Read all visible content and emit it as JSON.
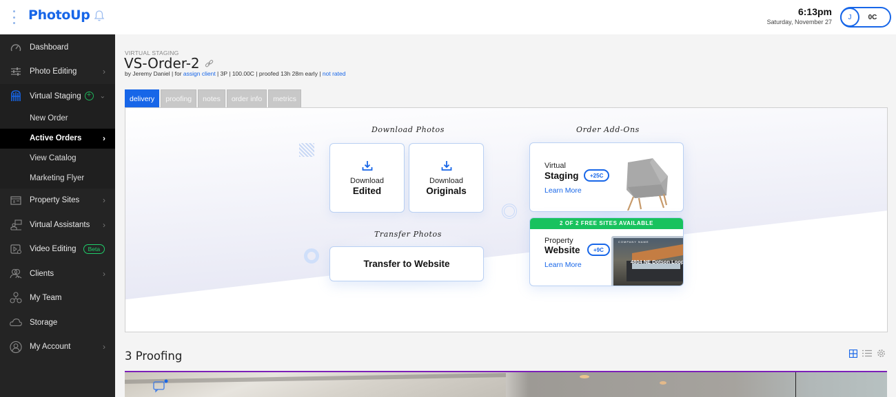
{
  "app": {
    "brand": "PhotoUp",
    "time": "6:13pm",
    "date": "Saturday, November 27",
    "account_initial": "J",
    "credits": "0C",
    "accent_color": "#1766e8"
  },
  "sidebar": {
    "items": [
      {
        "label": "Dashboard",
        "icon": "gauge-icon",
        "has_chevron": false
      },
      {
        "label": "Photo Editing",
        "icon": "sliders-icon",
        "has_chevron": true
      },
      {
        "label": "Virtual Staging",
        "icon": "chair-icon",
        "has_chevron": true,
        "expanded": true,
        "children": [
          {
            "label": "New Order"
          },
          {
            "label": "Active Orders",
            "active": true
          },
          {
            "label": "View Catalog"
          },
          {
            "label": "Marketing Flyer"
          }
        ]
      },
      {
        "label": "Property Sites",
        "icon": "website-icon",
        "has_chevron": true
      },
      {
        "label": "Virtual Assistants",
        "icon": "assistant-icon",
        "has_chevron": true
      },
      {
        "label": "Video Editing",
        "icon": "video-icon",
        "badge": "Beta"
      },
      {
        "label": "Clients",
        "icon": "clients-icon",
        "has_chevron": true
      },
      {
        "label": "My Team",
        "icon": "team-icon"
      },
      {
        "label": "Storage",
        "icon": "cloud-icon"
      },
      {
        "label": "My Account",
        "icon": "account-icon",
        "has_chevron": true
      }
    ]
  },
  "order": {
    "kicker": "VIRTUAL STAGING",
    "title": "VS-Order-2",
    "meta": {
      "by": "by Jeremy Daniel",
      "for_prefix": "for",
      "client_link": "assign client",
      "photos": "3P",
      "cost": "100.00C",
      "proofed": "proofed 13h 28m early",
      "rating_link": "not rated",
      "sep": " | "
    },
    "tabs": [
      "delivery",
      "proofing",
      "notes",
      "order info",
      "metrics"
    ],
    "active_tab": "delivery"
  },
  "delivery": {
    "download_heading": "Download Photos",
    "download_edited": {
      "line1": "Download",
      "line2": "Edited"
    },
    "download_originals": {
      "line1": "Download",
      "line2": "Originals"
    },
    "transfer_heading": "Transfer Photos",
    "transfer_button": "Transfer to Website",
    "addons_heading": "Order Add-Ons",
    "addon_staging": {
      "line1": "Virtual",
      "line2": "Staging",
      "price": "+25C",
      "link": "Learn More"
    },
    "addon_website": {
      "banner": "2 OF 2 FREE SITES AVAILABLE",
      "line1": "Property",
      "line2": "Website",
      "price": "+9C",
      "link": "Learn More",
      "preview_address": "4804 NE Dotson Loop",
      "preview_company": "COMPANY NAME"
    }
  },
  "proofing": {
    "title": "3 Proofing",
    "view_icons": [
      "grid-view-icon",
      "list-view-icon",
      "settings-icon"
    ]
  }
}
